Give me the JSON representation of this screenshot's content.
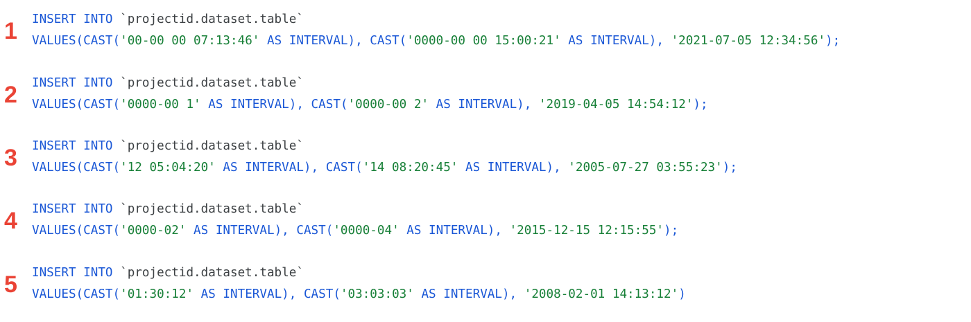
{
  "statements": [
    {
      "number": "1",
      "line1_kw": "INSERT INTO ",
      "line1_table": "`projectid.dataset.table`",
      "values_open": "VALUES(",
      "cast1_open": "CAST(",
      "cast1_value": "'00-00 00 07:13:46'",
      "cast1_close": " AS INTERVAL), ",
      "cast2_open": "CAST(",
      "cast2_value": "'0000-00 00 15:00:21'",
      "cast2_close": " AS INTERVAL), ",
      "timestamp": "'2021-07-05 12:34:56'",
      "end": ");"
    },
    {
      "number": "2",
      "line1_kw": "INSERT INTO ",
      "line1_table": "`projectid.dataset.table`",
      "values_open": "VALUES(",
      "cast1_open": "CAST(",
      "cast1_value": "'0000-00 1'",
      "cast1_close": " AS INTERVAL), ",
      "cast2_open": "CAST(",
      "cast2_value": "'0000-00 2'",
      "cast2_close": " AS INTERVAL), ",
      "timestamp": "'2019-04-05 14:54:12'",
      "end": ");"
    },
    {
      "number": "3",
      "line1_kw": "INSERT INTO ",
      "line1_table": "`projectid.dataset.table`",
      "values_open": "VALUES(",
      "cast1_open": "CAST(",
      "cast1_value": "'12 05:04:20'",
      "cast1_close": " AS INTERVAL), ",
      "cast2_open": "CAST(",
      "cast2_value": "'14 08:20:45'",
      "cast2_close": " AS INTERVAL), ",
      "timestamp": "'2005-07-27 03:55:23'",
      "end": ");"
    },
    {
      "number": "4",
      "line1_kw": "INSERT INTO ",
      "line1_table": "`projectid.dataset.table`",
      "values_open": "VALUES(",
      "cast1_open": "CAST(",
      "cast1_value": "'0000-02'",
      "cast1_close": " AS INTERVAL), ",
      "cast2_open": "CAST(",
      "cast2_value": "'0000-04'",
      "cast2_close": " AS INTERVAL), ",
      "timestamp": "'2015-12-15 12:15:55'",
      "end": ");"
    },
    {
      "number": "5",
      "line1_kw": "INSERT INTO ",
      "line1_table": "`projectid.dataset.table`",
      "values_open": "VALUES(",
      "cast1_open": "CAST(",
      "cast1_value": "'01:30:12'",
      "cast1_close": " AS INTERVAL), ",
      "cast2_open": "CAST(",
      "cast2_value": "'03:03:03'",
      "cast2_close": " AS INTERVAL), ",
      "timestamp": "'2008-02-01 14:13:12'",
      "end": ")"
    }
  ],
  "colors": {
    "number": "#ea4335",
    "keyword": "#1a57d6",
    "string": "#188038",
    "identifier": "#3c4043"
  }
}
